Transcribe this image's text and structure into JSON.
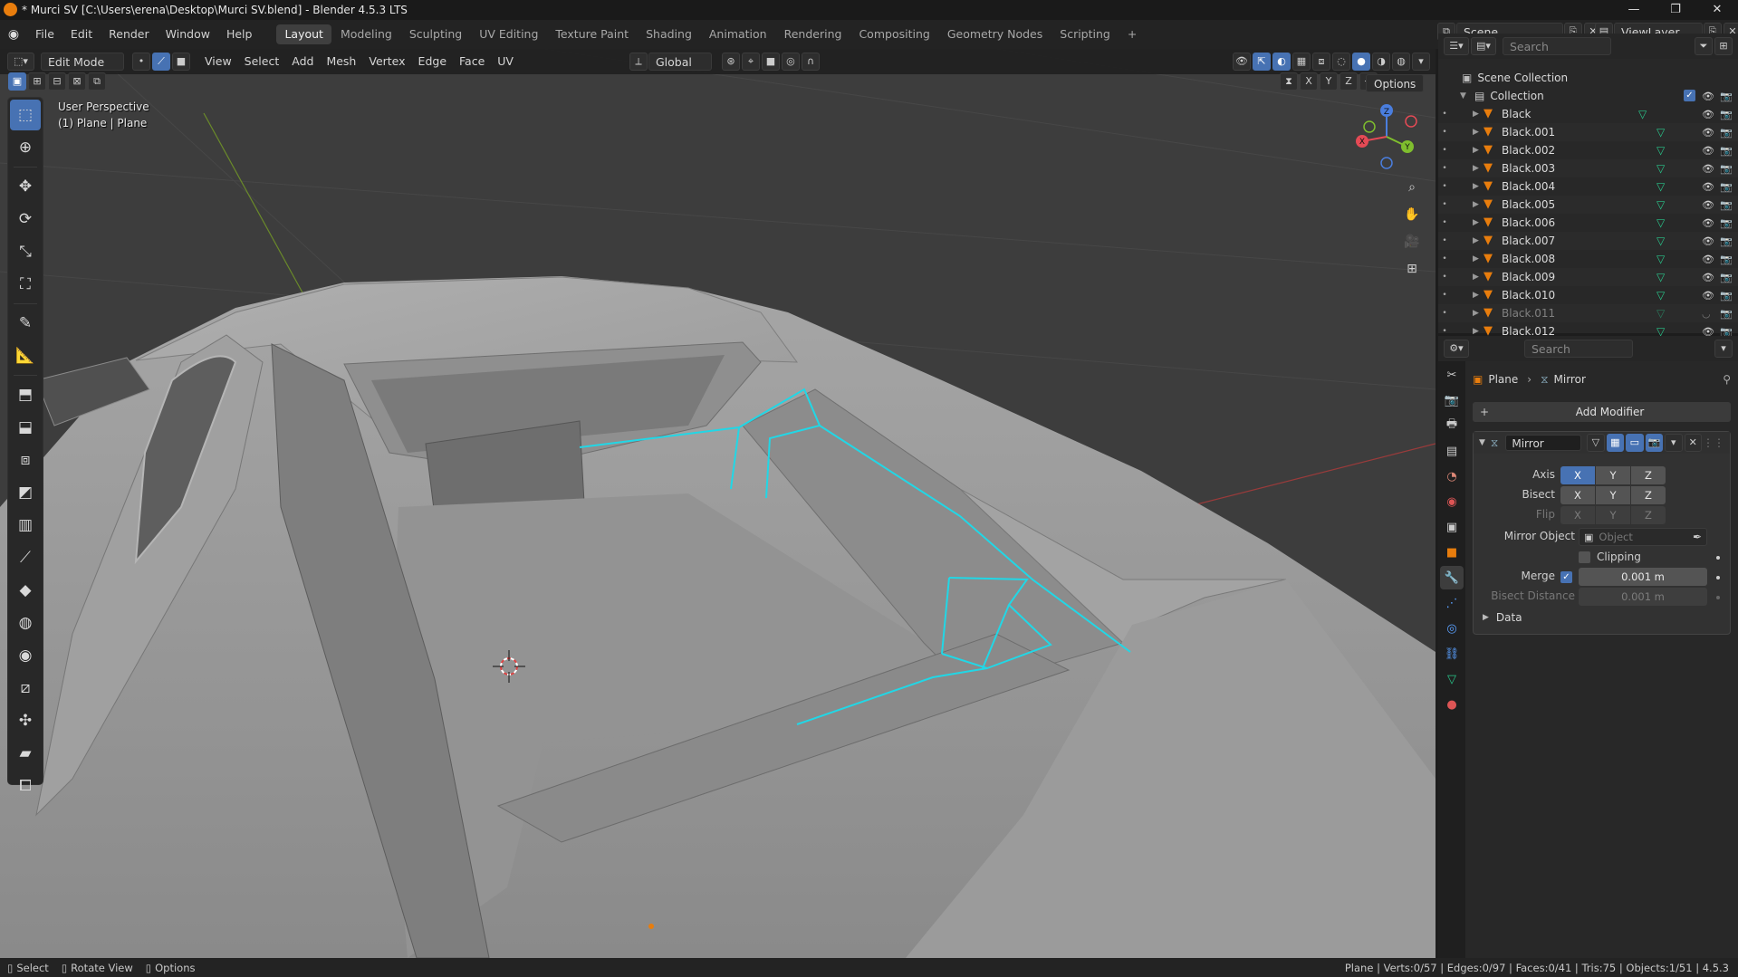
{
  "window": {
    "title": "* Murci SV [C:\\Users\\erena\\Desktop\\Murci SV.blend] - Blender 4.5.3 LTS",
    "minimize": "—",
    "maximize": "❐",
    "close": "✕"
  },
  "menus": [
    "File",
    "Edit",
    "Render",
    "Window",
    "Help"
  ],
  "workspaces": [
    "Layout",
    "Modeling",
    "Sculpting",
    "UV Editing",
    "Texture Paint",
    "Shading",
    "Animation",
    "Rendering",
    "Compositing",
    "Geometry Nodes",
    "Scripting"
  ],
  "active_workspace": "Layout",
  "add_workspace": "+",
  "scene": {
    "name": "Scene",
    "view_layer": "ViewLayer"
  },
  "viewport_header": {
    "mode": "Edit Mode",
    "menus": [
      "View",
      "Select",
      "Add",
      "Mesh",
      "Vertex",
      "Edge",
      "Face",
      "UV"
    ],
    "orientation": "Global",
    "options": "Options",
    "axes": [
      "X",
      "Y",
      "Z"
    ]
  },
  "viewport_info": {
    "line1": "User Perspective",
    "line2": "(1) Plane | Plane"
  },
  "gizmo": {
    "x": "X",
    "y": "Y",
    "z": "Z"
  },
  "outliner": {
    "search_placeholder": "Search",
    "root": "Scene Collection",
    "collection": "Collection",
    "items": [
      "Black",
      "Black.001",
      "Black.002",
      "Black.003",
      "Black.004",
      "Black.005",
      "Black.006",
      "Black.007",
      "Black.008",
      "Black.009",
      "Black.010",
      "Black.011",
      "Black.012"
    ]
  },
  "properties": {
    "search_placeholder": "Search",
    "breadcrumb_object": "Plane",
    "breadcrumb_modifier": "Mirror",
    "add_modifier": "Add Modifier",
    "modifier": {
      "name": "Mirror",
      "axis_label": "Axis",
      "bisect_label": "Bisect",
      "flip_label": "Flip",
      "xyz": [
        "X",
        "Y",
        "Z"
      ],
      "mirror_object_label": "Mirror Object",
      "mirror_object_placeholder": "Object",
      "clipping_label": "Clipping",
      "merge_label": "Merge",
      "merge_value": "0.001 m",
      "bisect_distance_label": "Bisect Distance",
      "bisect_distance_value": "0.001 m",
      "data_label": "Data"
    }
  },
  "statusbar": {
    "select": "Select",
    "rotate": "Rotate View",
    "options": "Options",
    "stats": "Plane | Verts:0/57 | Edges:0/97 | Faces:0/41 | Tris:75 | Objects:1/51 | 4.5.3"
  },
  "colors": {
    "accent": "#4772b3",
    "selected_edge": "#21d7e6",
    "object_orange": "#e87d0d",
    "mesh_green": "#29c58a"
  }
}
